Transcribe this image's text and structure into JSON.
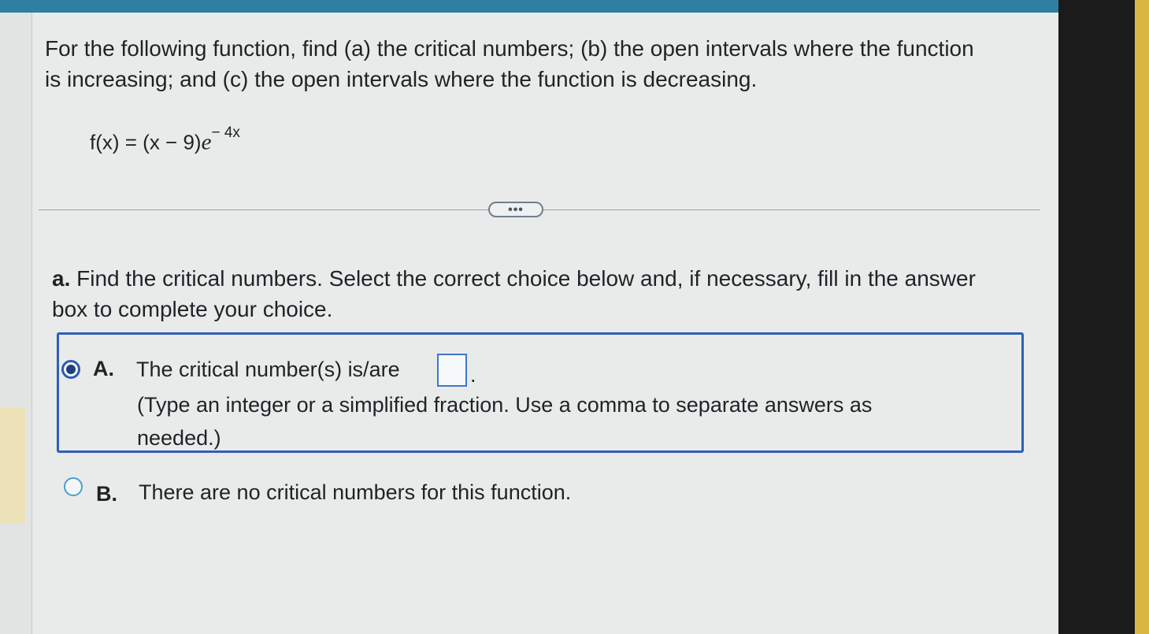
{
  "question": {
    "instructions": "For the following function, find (a) the critical numbers; (b) the open intervals where the function is increasing; and (c) the open intervals where the function is decreasing.",
    "function_base": "f(x) = (x − 9)",
    "function_e": "e",
    "function_exponent": "− 4x"
  },
  "divider": {
    "more_label": "•••"
  },
  "part_a": {
    "label": "a.",
    "prompt": "Find the critical numbers. Select the correct choice below and, if necessary, fill in the answer box to complete your choice.",
    "choices": [
      {
        "letter": "A.",
        "text": "The critical number(s) is/are",
        "answer_value": "",
        "after_box": ".",
        "hint": "(Type an integer or a simplified fraction. Use a comma to separate answers as needed.)",
        "selected": true
      },
      {
        "letter": "B.",
        "text": "There are no critical numbers for this function.",
        "selected": false
      }
    ]
  },
  "colors": {
    "accent_blue": "#2f5fb7",
    "top_bar": "#2e7fa2",
    "highlight": "#eee3b8"
  }
}
